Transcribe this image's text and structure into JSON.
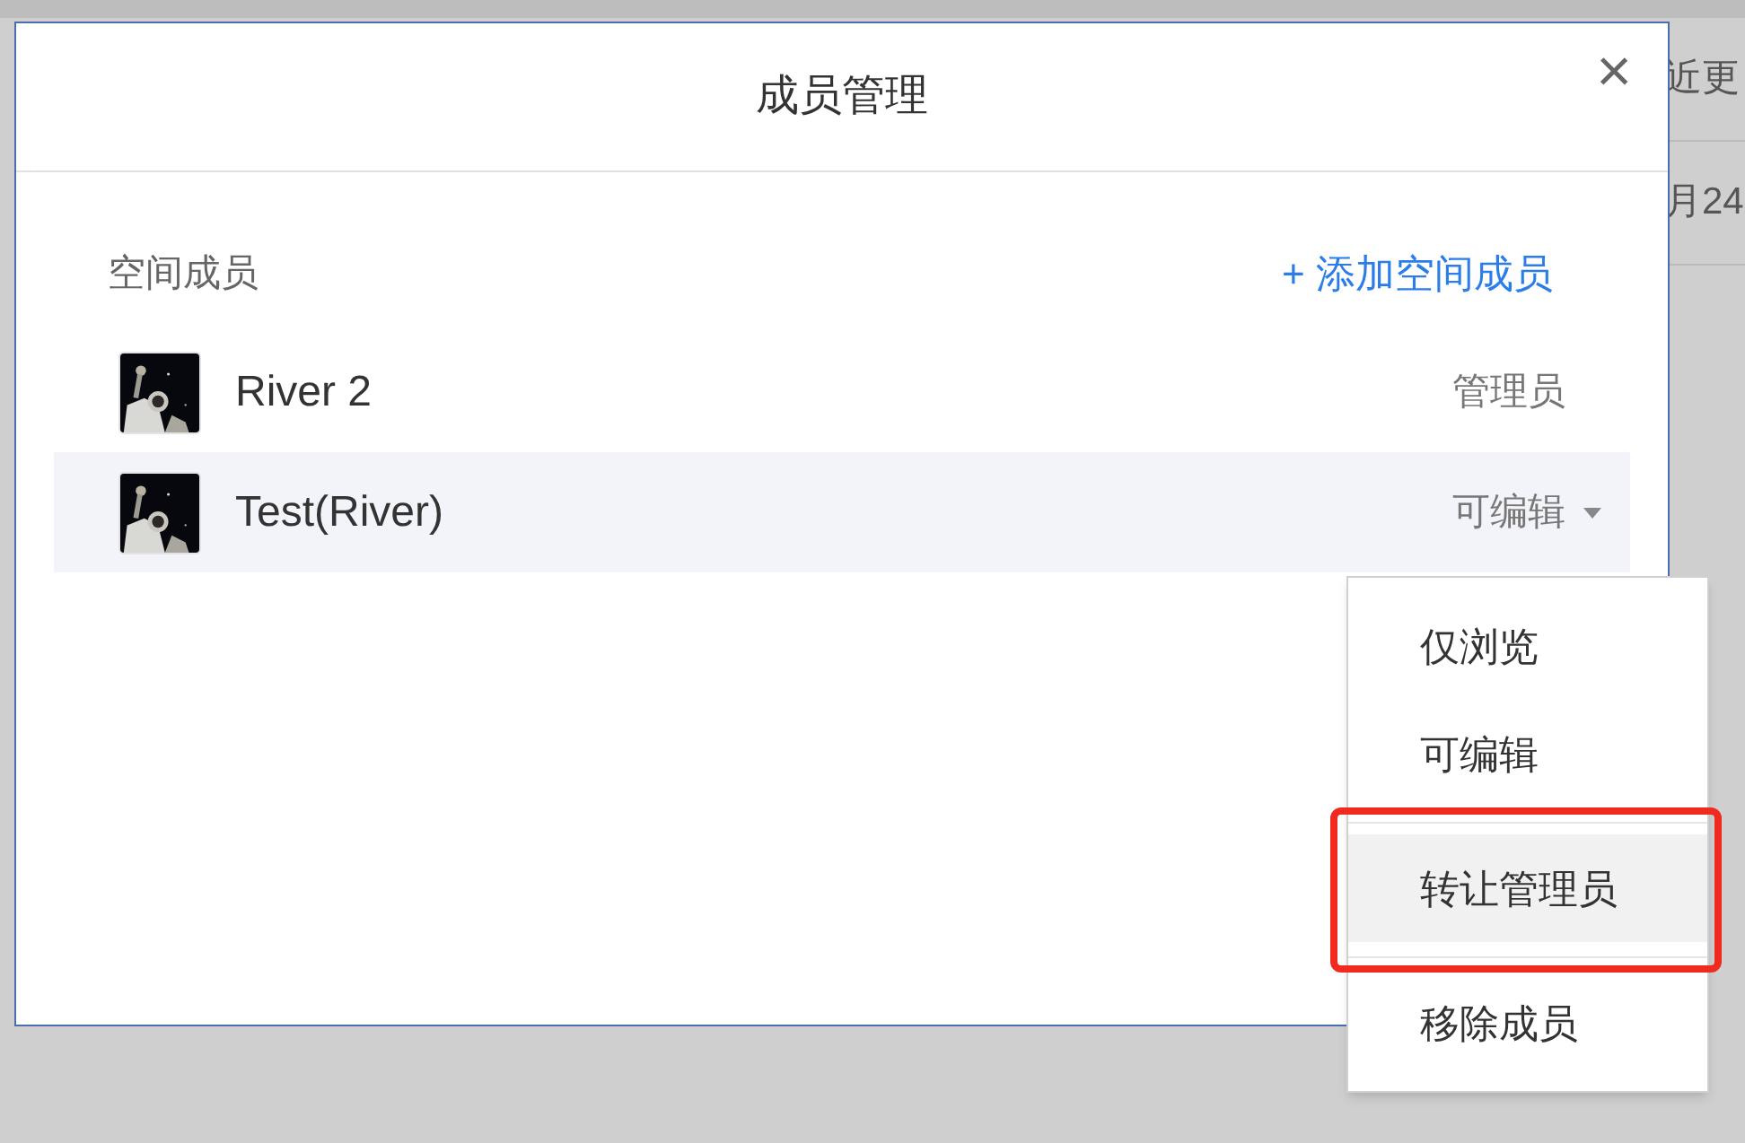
{
  "background_page": {
    "texts": [
      "近更",
      "月24"
    ]
  },
  "dialog": {
    "title": "成员管理",
    "close": "×"
  },
  "section": {
    "label": "空间成员",
    "add_link": "+ 添加空间成员"
  },
  "members": [
    {
      "name": "River 2",
      "role": "管理员",
      "has_dropdown": false,
      "selected": false
    },
    {
      "name": "Test(River)",
      "role": "可编辑",
      "has_dropdown": true,
      "selected": true
    }
  ],
  "role_menu": {
    "items": [
      {
        "label": "仅浏览",
        "highlighted": false,
        "divider_before": false
      },
      {
        "label": "可编辑",
        "highlighted": false,
        "divider_before": false
      },
      {
        "label": "转让管理员",
        "highlighted": true,
        "divider_before": true
      },
      {
        "label": "移除成员",
        "highlighted": false,
        "divider_before": true
      }
    ]
  },
  "annotation": {
    "kind": "box",
    "color": "#f02a1e"
  }
}
